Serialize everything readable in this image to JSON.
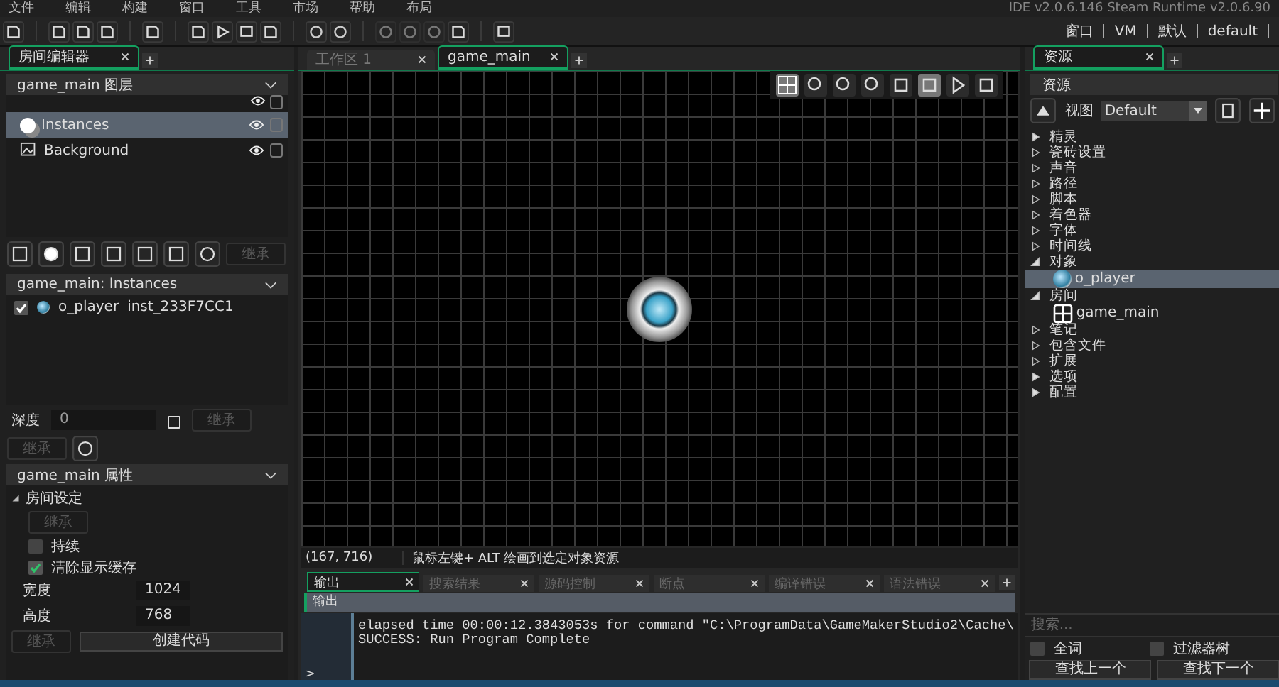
{
  "menu": [
    "文件",
    "编辑",
    "构建",
    "窗口",
    "工具",
    "市场",
    "帮助",
    "布局"
  ],
  "title": "IDE v2.0.6.146 Steam Runtime v2.0.6.90",
  "layout_links": [
    "窗口",
    "VM",
    "默认",
    "default"
  ],
  "left_tabs": [
    {
      "label": "房间编辑器",
      "selected": true
    }
  ],
  "layers": {
    "title": "game_main 图层",
    "items": [
      {
        "name": "Instances",
        "kind": "instance",
        "selected": true
      },
      {
        "name": "Background",
        "kind": "background",
        "selected": false
      }
    ],
    "inherit_button": "继承"
  },
  "instances": {
    "title": "game_main: Instances",
    "items": [
      {
        "object": "o_player",
        "id": "inst_233F7CC1",
        "checked": true
      }
    ]
  },
  "depth": {
    "label": "深度",
    "value": "0",
    "inherit_button": "继承",
    "inherit_button_2": "继承"
  },
  "properties": {
    "title": "game_main 属性",
    "section": "房间设定",
    "inherit_button": "继承",
    "options": [
      {
        "label": "持续",
        "checked": false
      },
      {
        "label": "清除显示缓存",
        "checked": true
      }
    ],
    "fields": [
      {
        "label": "宽度",
        "value": "1024"
      },
      {
        "label": "高度",
        "value": "768"
      }
    ],
    "inherit_button_2": "继承",
    "code_button": "创建代码"
  },
  "editor_tabs": [
    {
      "label": "工作区 1",
      "selected": false
    },
    {
      "label": "game_main",
      "selected": true
    }
  ],
  "status_bar": {
    "coords": "(167, 716)",
    "hint": "鼠标左键+ ALT 绘画到选定对象资源"
  },
  "output_tabs": [
    {
      "label": "输出",
      "selected": true
    },
    {
      "label": "搜索结果",
      "selected": false
    },
    {
      "label": "源码控制",
      "selected": false
    },
    {
      "label": "断点",
      "selected": false
    },
    {
      "label": "编译错误",
      "selected": false
    },
    {
      "label": "语法错误",
      "selected": false
    }
  ],
  "output": {
    "header": "输出",
    "lines": [
      "elapsed time 00:00:12.3843053s for command \"C:\\ProgramData\\GameMakerStudio2\\Cache\\",
      "SUCCESS: Run Program Complete"
    ],
    "prompt": ">"
  },
  "resources": {
    "tab": "资源",
    "title": "资源",
    "view_label": "视图",
    "view_value": "Default",
    "tree": [
      {
        "label": "精灵",
        "expanded": false,
        "empty": false
      },
      {
        "label": "瓷砖设置",
        "expanded": false,
        "empty": true
      },
      {
        "label": "声音",
        "expanded": false,
        "empty": true
      },
      {
        "label": "路径",
        "expanded": false,
        "empty": true
      },
      {
        "label": "脚本",
        "expanded": false,
        "empty": true
      },
      {
        "label": "着色器",
        "expanded": false,
        "empty": true
      },
      {
        "label": "字体",
        "expanded": false,
        "empty": true
      },
      {
        "label": "时间线",
        "expanded": false,
        "empty": true
      },
      {
        "label": "对象",
        "expanded": true,
        "empty": false,
        "children": [
          {
            "label": "o_player",
            "kind": "object",
            "selected": true
          }
        ]
      },
      {
        "label": "房间",
        "expanded": true,
        "empty": false,
        "children": [
          {
            "label": "game_main",
            "kind": "room",
            "selected": false
          }
        ]
      },
      {
        "label": "笔记",
        "expanded": false,
        "empty": true
      },
      {
        "label": "包含文件",
        "expanded": false,
        "empty": true
      },
      {
        "label": "扩展",
        "expanded": false,
        "empty": true
      },
      {
        "label": "选项",
        "expanded": false,
        "empty": false
      },
      {
        "label": "配置",
        "expanded": false,
        "empty": false
      }
    ],
    "search": {
      "placeholder": "搜索..."
    },
    "options": [
      {
        "label": "全词",
        "checked": false
      },
      {
        "label": "过滤器树",
        "checked": false
      }
    ],
    "buttons": [
      "查找上一个",
      "查找下一个"
    ]
  }
}
